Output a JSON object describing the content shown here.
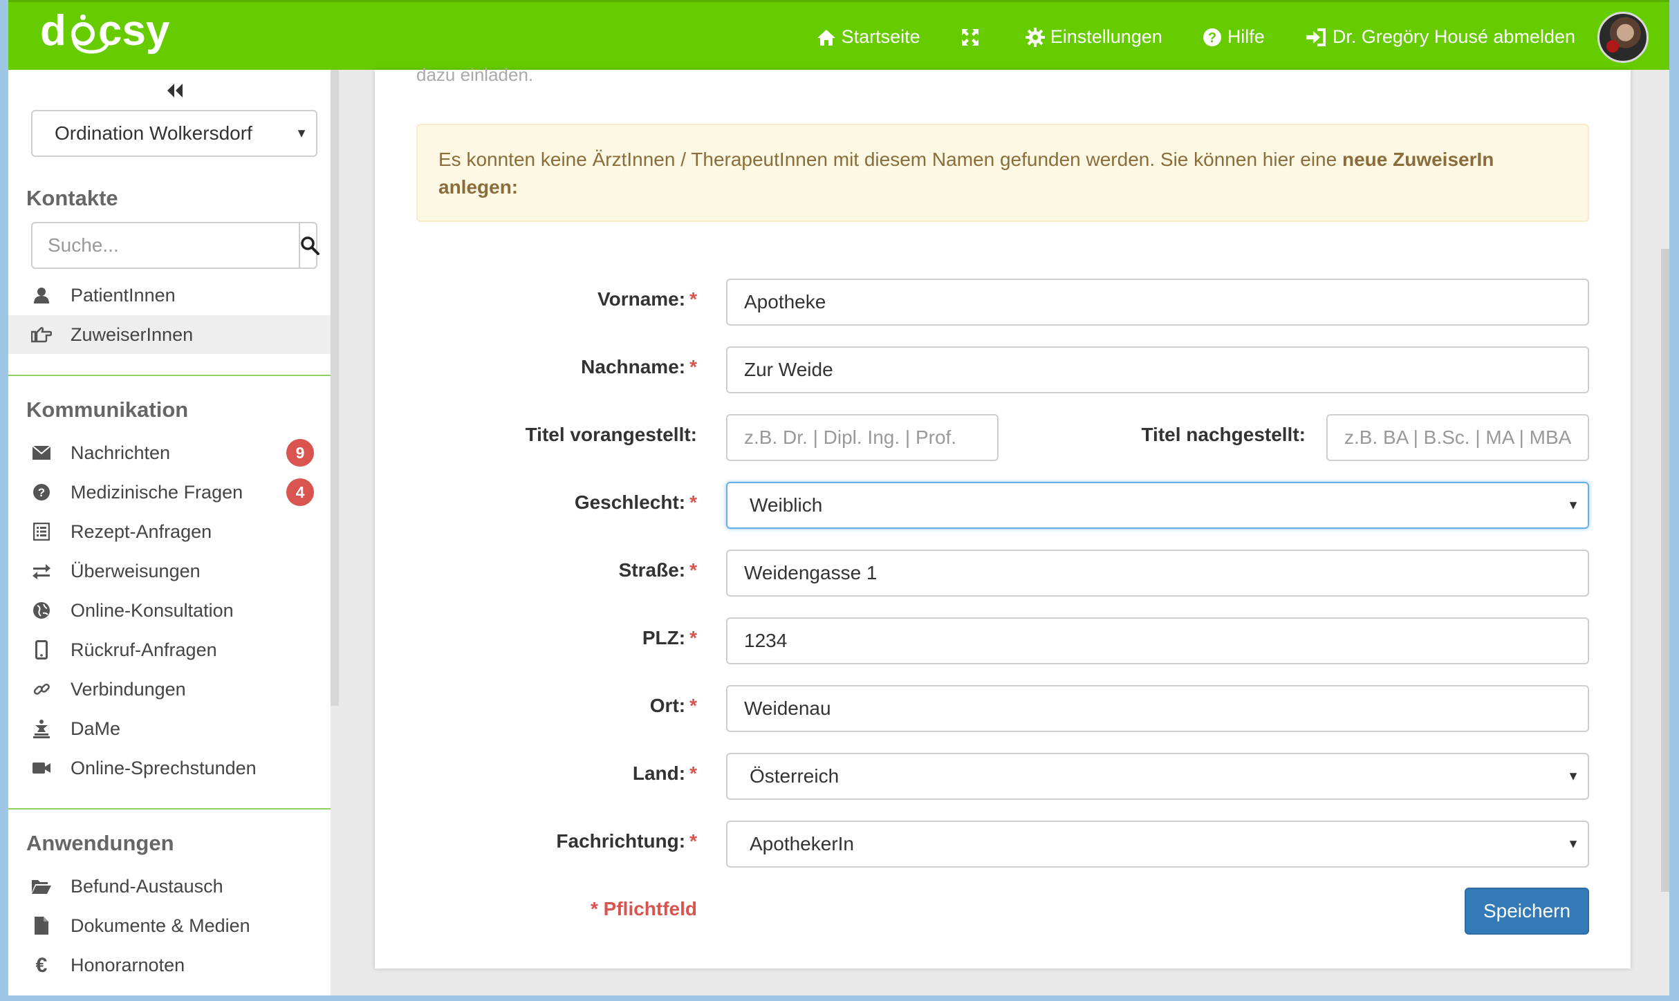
{
  "app": {
    "brand": "docsy",
    "brand_color": "#66cc00"
  },
  "topnav": {
    "home": {
      "label": "Startseite",
      "icon": "home-icon"
    },
    "fullscreen": {
      "icon": "fullscreen-icon"
    },
    "settings": {
      "label": "Einstellungen",
      "icon": "gear-icon"
    },
    "help": {
      "label": "Hilfe",
      "icon": "help-icon"
    },
    "logout": {
      "label": "Dr. Gregöry Housé abmelden",
      "icon": "sign-out-icon"
    }
  },
  "sidebar": {
    "practice": "Ordination Wolkersdorf",
    "contacts_title": "Kontakte",
    "search_placeholder": "Suche...",
    "contacts": [
      {
        "label": "PatientInnen",
        "icon": "user-icon"
      },
      {
        "label": "ZuweiserInnen",
        "icon": "hand-pointing-icon",
        "active": true
      }
    ],
    "communication_title": "Kommunikation",
    "communication": [
      {
        "label": "Nachrichten",
        "icon": "envelope-icon",
        "badge": "9"
      },
      {
        "label": "Medizinische Fragen",
        "icon": "question-circle-icon",
        "badge": "4"
      },
      {
        "label": "Rezept-Anfragen",
        "icon": "list-icon"
      },
      {
        "label": "Überweisungen",
        "icon": "exchange-icon"
      },
      {
        "label": "Online-Konsultation",
        "icon": "globe-icon"
      },
      {
        "label": "Rückruf-Anfragen",
        "icon": "mobile-icon"
      },
      {
        "label": "Verbindungen",
        "icon": "link-icon"
      },
      {
        "label": "DaMe",
        "icon": "dame-icon"
      },
      {
        "label": "Online-Sprechstunden",
        "icon": "video-camera-icon"
      }
    ],
    "applications_title": "Anwendungen",
    "applications": [
      {
        "label": "Befund-Austausch",
        "icon": "folder-open-icon"
      },
      {
        "label": "Dokumente & Medien",
        "icon": "file-icon"
      },
      {
        "label": "Honorarnoten",
        "icon": "euro-icon"
      }
    ]
  },
  "main": {
    "cut_text": "dazu einladen.",
    "alert_text": "Es konnten keine ÄrztInnen / TherapeutInnen mit diesem Namen gefunden werden. Sie können hier eine ",
    "alert_bold": "neue ZuweiserIn anlegen:",
    "form": {
      "first_name": {
        "label": "Vorname:",
        "value": "Apotheke"
      },
      "last_name": {
        "label": "Nachname:",
        "value": "Zur Weide"
      },
      "title_prefix": {
        "label": "Titel vorangestellt:",
        "placeholder": "z.B. Dr. | Dipl. Ing. | Prof."
      },
      "title_suffix": {
        "label": "Titel nachgestellt:",
        "placeholder": "z.B. BA | B.Sc. | MA | MBA"
      },
      "gender": {
        "label": "Geschlecht:",
        "value": "Weiblich"
      },
      "street": {
        "label": "Straße:",
        "value": "Weidengasse 1"
      },
      "zip": {
        "label": "PLZ:",
        "value": "1234"
      },
      "city": {
        "label": "Ort:",
        "value": "Weidenau"
      },
      "country": {
        "label": "Land:",
        "value": "Österreich"
      },
      "specialty": {
        "label": "Fachrichtung:",
        "value": "ApothekerIn"
      },
      "required_marker": "*",
      "required_note": "* Pflichtfeld",
      "save_label": "Speichern"
    }
  }
}
